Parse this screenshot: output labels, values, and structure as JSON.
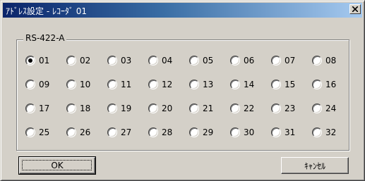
{
  "window": {
    "title": "ｱﾄﾞﾚｽ設定 - ﾚｺｰﾀﾞ 01"
  },
  "group": {
    "label": "RS-422-A"
  },
  "radio_options": [
    {
      "label": "01",
      "checked": true
    },
    {
      "label": "02",
      "checked": false
    },
    {
      "label": "03",
      "checked": false
    },
    {
      "label": "04",
      "checked": false
    },
    {
      "label": "05",
      "checked": false
    },
    {
      "label": "06",
      "checked": false
    },
    {
      "label": "07",
      "checked": false
    },
    {
      "label": "08",
      "checked": false
    },
    {
      "label": "09",
      "checked": false
    },
    {
      "label": "10",
      "checked": false
    },
    {
      "label": "11",
      "checked": false
    },
    {
      "label": "12",
      "checked": false
    },
    {
      "label": "13",
      "checked": false
    },
    {
      "label": "14",
      "checked": false
    },
    {
      "label": "15",
      "checked": false
    },
    {
      "label": "16",
      "checked": false
    },
    {
      "label": "17",
      "checked": false
    },
    {
      "label": "18",
      "checked": false
    },
    {
      "label": "19",
      "checked": false
    },
    {
      "label": "20",
      "checked": false
    },
    {
      "label": "21",
      "checked": false
    },
    {
      "label": "22",
      "checked": false
    },
    {
      "label": "23",
      "checked": false
    },
    {
      "label": "24",
      "checked": false
    },
    {
      "label": "25",
      "checked": false
    },
    {
      "label": "26",
      "checked": false
    },
    {
      "label": "27",
      "checked": false
    },
    {
      "label": "28",
      "checked": false
    },
    {
      "label": "29",
      "checked": false
    },
    {
      "label": "30",
      "checked": false
    },
    {
      "label": "31",
      "checked": false
    },
    {
      "label": "32",
      "checked": false
    }
  ],
  "buttons": {
    "ok_label": "OK",
    "cancel_label": "ｷｬﾝｾﾙ"
  },
  "icons": {
    "close": "close-icon"
  },
  "colors": {
    "titlebar_start": "#0a246a",
    "titlebar_end": "#a6caf0",
    "face": "#d4d0c8"
  }
}
